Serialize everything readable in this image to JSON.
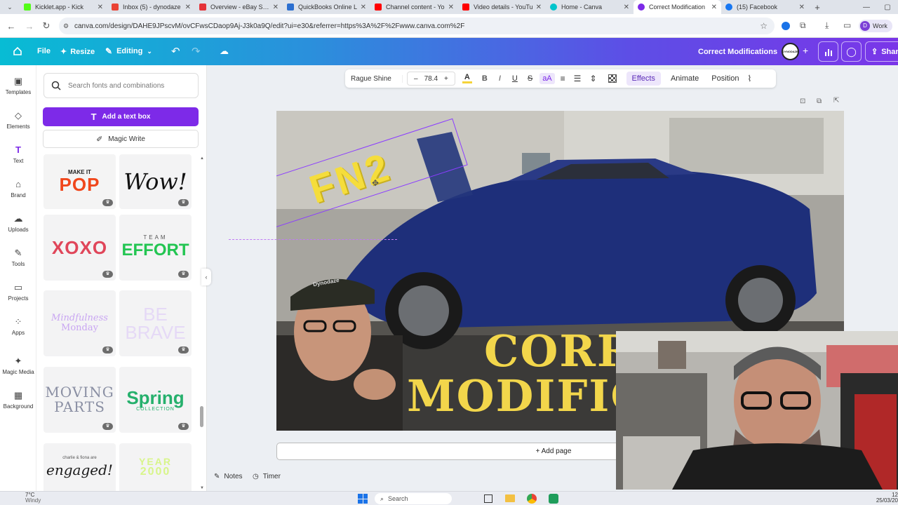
{
  "browser": {
    "tabs": [
      {
        "title": "Kicklet.app - Kick",
        "color": "#53fc18"
      },
      {
        "title": "Inbox (5) - dynodaze",
        "color": "#ea4335"
      },
      {
        "title": "Overview - eBay Selle",
        "color": "#e53238"
      },
      {
        "title": "QuickBooks Online L",
        "color": "#2ca01c"
      },
      {
        "title": "Channel content - Yo",
        "color": "#ff0000"
      },
      {
        "title": "Video details - YouTu",
        "color": "#ff0000"
      },
      {
        "title": "Home - Canva",
        "color": "#00c4cc"
      },
      {
        "title": "Correct Modification",
        "color": "#7d2ae8"
      },
      {
        "title": "(15) Facebook",
        "color": "#1877f2"
      }
    ],
    "url": "canva.com/design/DAHE9JPscvM/ovCFwsCDaop9Aj-J3k0a9Q/edit?ui=e30&referrer=https%3A%2F%2Fwww.canva.com%2F",
    "profile_label": "Work",
    "profile_initial": "D"
  },
  "canva_header": {
    "file": "File",
    "resize": "Resize",
    "editing": "Editing",
    "design_title": "Correct Modifications",
    "share": "Share",
    "avatar": "DYNODAZE"
  },
  "rail": [
    {
      "label": "Templates",
      "icon": "▣"
    },
    {
      "label": "Elements",
      "icon": "◇"
    },
    {
      "label": "Text",
      "icon": "T"
    },
    {
      "label": "Brand",
      "icon": "⌂"
    },
    {
      "label": "Uploads",
      "icon": "☁"
    },
    {
      "label": "Tools",
      "icon": "✎"
    },
    {
      "label": "Projects",
      "icon": "▭"
    },
    {
      "label": "Apps",
      "icon": "⁘"
    },
    {
      "label": "Magic Media",
      "icon": "✦"
    },
    {
      "label": "Background",
      "icon": "▦"
    }
  ],
  "panel": {
    "search_placeholder": "Search fonts and combinations",
    "add_text_box": "Add a text box",
    "magic_write": "Magic Write",
    "tiles": [
      {
        "line1": "MAKE IT",
        "line2": "POP"
      },
      {
        "line1": "Wow!",
        "line2": ""
      },
      {
        "line1": "XOXO",
        "line2": ""
      },
      {
        "line1": "TEAM",
        "line2": "EFFORT"
      },
      {
        "line1": "Mindfulness",
        "line2": "Monday"
      },
      {
        "line1": "BE",
        "line2": "BRAVE"
      },
      {
        "line1": "MOVING",
        "line2": "PARTS"
      },
      {
        "line1": "Spring",
        "line2": "COLLECTION"
      },
      {
        "line1": "charlie & fiona are",
        "line2": "engaged!"
      },
      {
        "line1": "YEAR",
        "line2": "2000"
      }
    ]
  },
  "toolbar": {
    "font": "Rague Shine",
    "size": "78.4",
    "minus": "–",
    "plus": "+",
    "bold": "B",
    "italic": "I",
    "underline": "U",
    "strike": "S",
    "case": "aA",
    "effects": "Effects",
    "animate": "Animate",
    "position": "Position"
  },
  "design": {
    "sticker_text": "FN2",
    "headline_1": "CORR",
    "headline_2": "MODIFIC",
    "cap_text": "Dynodaze",
    "add_page": "+ Add page"
  },
  "footer": {
    "notes": "Notes",
    "timer": "Timer"
  },
  "taskbar": {
    "weather_temp": "7°C",
    "weather_desc": "Windy",
    "search": "Search",
    "time": "12",
    "date": "25/03/20"
  }
}
